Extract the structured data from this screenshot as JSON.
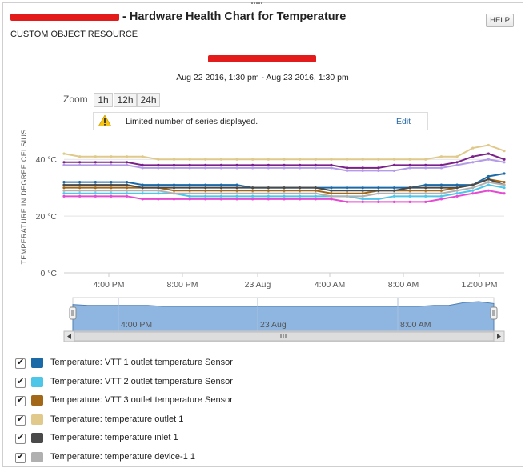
{
  "header": {
    "title": " - Hardware Health Chart for Temperature",
    "subtitle": "CUSTOM OBJECT RESOURCE",
    "help_label": "HELP",
    "date_range": "Aug 22 2016, 1:30 pm - Aug 23 2016, 1:30 pm"
  },
  "zoom": {
    "label": "Zoom",
    "options": [
      "1h",
      "12h",
      "24h"
    ]
  },
  "warning": {
    "text": "Limited number of series displayed.",
    "edit_label": "Edit"
  },
  "colors": {
    "navigator_fill": "#8fb6e0",
    "accent": "#2a6aa8",
    "redaction": "#e31b1b"
  },
  "chart_data": {
    "type": "line",
    "ylabel": "TEMPERATURE IN DEGREE CELSIUS",
    "yticks": [
      "0 °C",
      "20 °C",
      "40 °C"
    ],
    "ylim": [
      0,
      57
    ],
    "xticks": [
      "4:00 PM",
      "8:00 PM",
      "23 Aug",
      "4:00 AM",
      "8:00 AM",
      "12:00 PM"
    ],
    "navigator_xticks": [
      "4:00 PM",
      "23 Aug",
      "8:00 AM"
    ],
    "series": [
      {
        "name": "Temperature: VTT 1 outlet temperature Sensor",
        "color": "#1a6aa8",
        "values": [
          32,
          32,
          32,
          32,
          32,
          31,
          31,
          31,
          31,
          31,
          31,
          31,
          30,
          30,
          30,
          30,
          30,
          30,
          30,
          30,
          30,
          30,
          30,
          31,
          31,
          31,
          31,
          34,
          35
        ]
      },
      {
        "name": "Temperature: VTT 2 outlet temperature Sensor",
        "color": "#4ec6e8",
        "values": [
          28,
          28,
          28,
          28,
          28,
          28,
          28,
          28,
          27,
          27,
          27,
          27,
          27,
          27,
          27,
          27,
          27,
          27,
          27,
          26,
          26,
          27,
          27,
          27,
          27,
          28,
          29,
          31,
          30
        ]
      },
      {
        "name": "Temperature: VTT 3 outlet temperature Sensor",
        "color": "#a26818",
        "values": [
          30,
          30,
          30,
          30,
          30,
          30,
          30,
          29,
          29,
          29,
          29,
          29,
          29,
          29,
          29,
          29,
          29,
          28,
          28,
          28,
          29,
          29,
          29,
          29,
          29,
          30,
          31,
          33,
          32
        ]
      },
      {
        "name": "Temperature: temperature outlet 1",
        "color": "#e0c98a",
        "values": [
          42,
          41,
          41,
          41,
          41,
          41,
          40,
          40,
          40,
          40,
          40,
          40,
          40,
          40,
          40,
          40,
          40,
          40,
          40,
          40,
          40,
          40,
          40,
          40,
          41,
          41,
          44,
          45,
          43
        ]
      },
      {
        "name": "Temperature: temperature inlet 1",
        "color": "#4a4a4a",
        "values": [
          31,
          31,
          31,
          31,
          31,
          30,
          30,
          30,
          30,
          30,
          30,
          30,
          30,
          30,
          30,
          30,
          30,
          29,
          29,
          29,
          29,
          29,
          30,
          30,
          30,
          30,
          31,
          33,
          31
        ]
      },
      {
        "name": "Temperature: temperature device-1 1",
        "color": "#b0b0b0",
        "values": [
          29,
          29,
          29,
          29,
          29,
          29,
          29,
          28,
          28,
          28,
          28,
          28,
          28,
          28,
          28,
          28,
          28,
          27,
          27,
          27,
          28,
          28,
          28,
          28,
          28,
          29,
          30,
          32,
          31
        ]
      },
      {
        "name": "",
        "color": "#7a2288",
        "values": [
          39,
          39,
          39,
          39,
          39,
          38,
          38,
          38,
          38,
          38,
          38,
          38,
          38,
          38,
          38,
          38,
          38,
          38,
          37,
          37,
          37,
          38,
          38,
          38,
          38,
          39,
          41,
          42,
          40
        ]
      },
      {
        "name": "",
        "color": "#b39be6",
        "values": [
          38,
          38,
          38,
          38,
          38,
          37,
          37,
          37,
          37,
          37,
          37,
          37,
          37,
          37,
          37,
          37,
          37,
          37,
          36,
          36,
          36,
          36,
          37,
          37,
          37,
          38,
          39,
          40,
          39
        ]
      },
      {
        "name": "",
        "color": "#e54bd2",
        "values": [
          27,
          27,
          27,
          27,
          27,
          26,
          26,
          26,
          26,
          26,
          26,
          26,
          26,
          26,
          26,
          26,
          26,
          26,
          25,
          25,
          25,
          25,
          25,
          25,
          26,
          27,
          28,
          29,
          28
        ]
      }
    ]
  },
  "legend": [
    {
      "label": "Temperature: VTT 1 outlet temperature Sensor",
      "color": "#1a6aa8"
    },
    {
      "label": "Temperature: VTT 2 outlet temperature Sensor",
      "color": "#4ec6e8"
    },
    {
      "label": "Temperature: VTT 3 outlet temperature Sensor",
      "color": "#a26818"
    },
    {
      "label": "Temperature: temperature outlet 1",
      "color": "#e0c98a"
    },
    {
      "label": "Temperature: temperature inlet 1",
      "color": "#4a4a4a"
    },
    {
      "label": "Temperature: temperature device-1 1",
      "color": "#b0b0b0"
    }
  ]
}
